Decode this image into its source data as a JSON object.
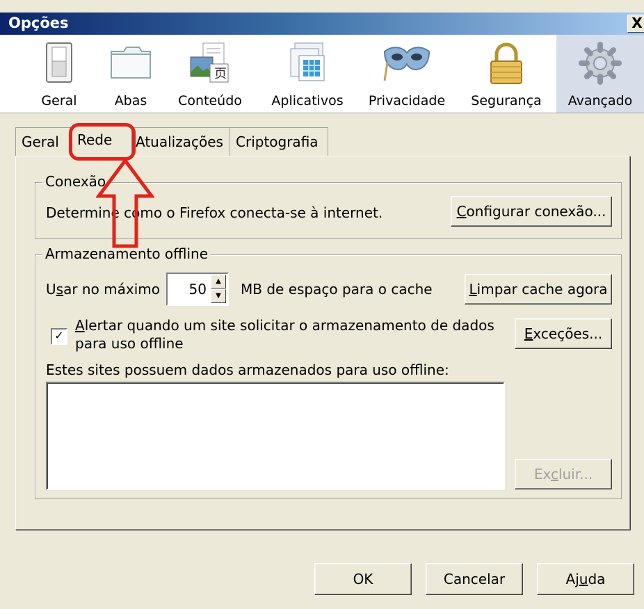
{
  "window": {
    "title": "Opções",
    "close_label": "X"
  },
  "toolbar": {
    "panes": [
      {
        "label": "Geral",
        "icon": "switch-icon",
        "selected": false
      },
      {
        "label": "Abas",
        "icon": "folder-tabs-icon",
        "selected": false
      },
      {
        "label": "Conteúdo",
        "icon": "content-icon",
        "selected": false
      },
      {
        "label": "Aplicativos",
        "icon": "applications-icon",
        "selected": false
      },
      {
        "label": "Privacidade",
        "icon": "mask-icon",
        "selected": false
      },
      {
        "label": "Segurança",
        "icon": "padlock-icon",
        "selected": false
      },
      {
        "label": "Avançado",
        "icon": "gear-icon",
        "selected": true
      }
    ]
  },
  "tabs": [
    {
      "label": "Geral",
      "active": false
    },
    {
      "label": "Rede",
      "active": true
    },
    {
      "label": "Atualizações",
      "active": false
    },
    {
      "label": "Criptografia",
      "active": false
    }
  ],
  "connection": {
    "title": "Conexão",
    "description": "Determine como o Firefox conecta-se à internet.",
    "configure_button": {
      "accel": "C",
      "rest": "onfigurar conexão..."
    }
  },
  "offline": {
    "title": "Armazenamento offline",
    "max_label": {
      "pre": "U",
      "accel": "s",
      "rest": "ar no máximo"
    },
    "cache_value": "50",
    "cache_unit": "MB de espaço para o cache",
    "clear_button": {
      "accel": "L",
      "rest": "impar cache agora"
    },
    "alert_checkbox": {
      "checked": true,
      "accel": "A",
      "line1_rest": "lertar quando um site solicitar o armazenamento de dados",
      "line2": "para uso offline"
    },
    "exceptions_button": {
      "accel": "E",
      "rest": "xceções..."
    },
    "sites_label": "Estes sites possuem dados armazenados para uso offline:",
    "sites": [],
    "delete_button": {
      "pre": "Ex",
      "accel": "c",
      "rest": "luir..."
    }
  },
  "footer": {
    "ok": "OK",
    "cancel": "Cancelar",
    "help": {
      "pre": "Aj",
      "accel": "u",
      "rest": "da"
    }
  },
  "annotation": {
    "color": "#E2231A"
  }
}
